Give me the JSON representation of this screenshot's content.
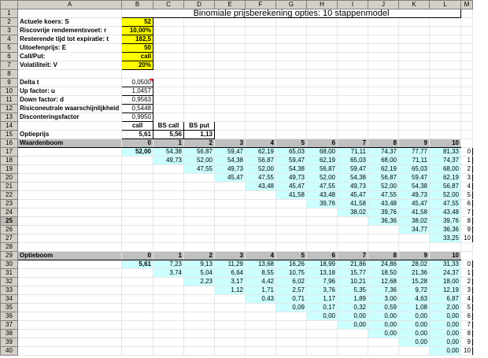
{
  "columns": [
    "A",
    "B",
    "C",
    "D",
    "E",
    "F",
    "G",
    "H",
    "I",
    "J",
    "K",
    "L",
    "M"
  ],
  "title": "Binomiale prijsberekening opties: 10 stappenmodel",
  "inputs": [
    {
      "label": "Actuele koers: S",
      "value": "52"
    },
    {
      "label": "Riscovrije rendementsvoet: r",
      "value": "10,00%"
    },
    {
      "label": "Resterende tijd tot expiratie: t",
      "value": "182,5"
    },
    {
      "label": "Uitoefenprijs: E",
      "value": "50"
    },
    {
      "label": "Call/Put:",
      "value": "call"
    },
    {
      "label": "Volatiliteit: V",
      "value": "20%"
    }
  ],
  "params": [
    {
      "label": "Delta t",
      "value": "0,0500"
    },
    {
      "label": "Up factor: u",
      "value": "1,0457"
    },
    {
      "label": "Down factor: d",
      "value": "0,9563"
    },
    {
      "label": "Risiconeutrale waarschijnlijkheid",
      "value": "0,5448"
    },
    {
      "label": "Disconteringsfactor",
      "value": "0,9950"
    }
  ],
  "price_header": {
    "b": "call",
    "c": "BS call",
    "d": "BS put"
  },
  "option_price": {
    "label": "Optieprijs",
    "b": "5,61",
    "c": "5,56",
    "d": "1,13"
  },
  "tree1_label": "Waardenboom",
  "tree2_label": "Optieboom",
  "steps": [
    "0",
    "1",
    "2",
    "3",
    "4",
    "5",
    "6",
    "7",
    "8",
    "9",
    "10"
  ],
  "value_tree": [
    [
      "52,00",
      "54,38",
      "56,87",
      "59,47",
      "62,19",
      "65,03",
      "68,00",
      "71,11",
      "74,37",
      "77,77",
      "81,33"
    ],
    [
      "",
      "49,73",
      "52,00",
      "54,38",
      "56,87",
      "59,47",
      "62,19",
      "65,03",
      "68,00",
      "71,11",
      "74,37"
    ],
    [
      "",
      "",
      "47,55",
      "49,73",
      "52,00",
      "54,38",
      "56,87",
      "59,47",
      "62,19",
      "65,03",
      "68,00"
    ],
    [
      "",
      "",
      "",
      "45,47",
      "47,55",
      "49,73",
      "52,00",
      "54,38",
      "56,87",
      "59,47",
      "62,19"
    ],
    [
      "",
      "",
      "",
      "",
      "43,48",
      "45,47",
      "47,55",
      "49,73",
      "52,00",
      "54,38",
      "56,87"
    ],
    [
      "",
      "",
      "",
      "",
      "",
      "41,58",
      "43,48",
      "45,47",
      "47,55",
      "49,73",
      "52,00"
    ],
    [
      "",
      "",
      "",
      "",
      "",
      "",
      "39,76",
      "41,58",
      "43,48",
      "45,47",
      "47,55"
    ],
    [
      "",
      "",
      "",
      "",
      "",
      "",
      "",
      "38,02",
      "39,76",
      "41,58",
      "43,48"
    ],
    [
      "",
      "",
      "",
      "",
      "",
      "",
      "",
      "",
      "36,36",
      "38,02",
      "39,76"
    ],
    [
      "",
      "",
      "",
      "",
      "",
      "",
      "",
      "",
      "",
      "34,77",
      "36,36"
    ],
    [
      "",
      "",
      "",
      "",
      "",
      "",
      "",
      "",
      "",
      "",
      "33,25"
    ]
  ],
  "option_tree": [
    [
      "5,61",
      "7,23",
      "9,13",
      "11,29",
      "13,68",
      "16,26",
      "18,99",
      "21,86",
      "24,86",
      "28,02",
      "31,33"
    ],
    [
      "",
      "3,74",
      "5,04",
      "6,64",
      "8,55",
      "10,75",
      "13,18",
      "15,77",
      "18,50",
      "21,36",
      "24,37"
    ],
    [
      "",
      "",
      "2,23",
      "3,17",
      "4,42",
      "6,02",
      "7,96",
      "10,21",
      "12,68",
      "15,28",
      "18,00"
    ],
    [
      "",
      "",
      "",
      "1,12",
      "1,71",
      "2,57",
      "3,76",
      "5,35",
      "7,36",
      "9,72",
      "12,19"
    ],
    [
      "",
      "",
      "",
      "",
      "0,43",
      "0,71",
      "1,17",
      "1,89",
      "3,00",
      "4,63",
      "6,87"
    ],
    [
      "",
      "",
      "",
      "",
      "",
      "0,09",
      "0,17",
      "0,32",
      "0,59",
      "1,08",
      "2,00"
    ],
    [
      "",
      "",
      "",
      "",
      "",
      "",
      "0,00",
      "0,00",
      "0,00",
      "0,00",
      "0,00"
    ],
    [
      "",
      "",
      "",
      "",
      "",
      "",
      "",
      "0,00",
      "0,00",
      "0,00",
      "0,00"
    ],
    [
      "",
      "",
      "",
      "",
      "",
      "",
      "",
      "",
      "0,00",
      "0,00",
      "0,00"
    ],
    [
      "",
      "",
      "",
      "",
      "",
      "",
      "",
      "",
      "",
      "0,00",
      "0,00"
    ],
    [
      "",
      "",
      "",
      "",
      "",
      "",
      "",
      "",
      "",
      "",
      "0,00"
    ]
  ],
  "row_index": [
    "0",
    "1",
    "2",
    "3",
    "4",
    "5",
    "6",
    "7",
    "8",
    "9",
    "10"
  ]
}
